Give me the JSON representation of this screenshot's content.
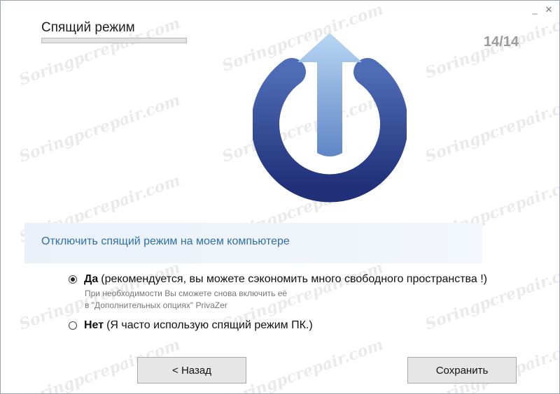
{
  "window": {
    "minimize_glyph": "_",
    "close_glyph": "✕"
  },
  "header": {
    "title": "Спящий режим",
    "counter": "14/14",
    "progress": 1.0
  },
  "section": {
    "heading": "Отключить спящий режим на моем компьютере"
  },
  "options": [
    {
      "bold": "Да",
      "text": "(рекомендуется, вы можете сэкономить много свободного пространства !)",
      "hint_line1": "При необходимости Вы сможете снова включить её",
      "hint_line2": "в \"Дополнительных опциях\" PrivaZer",
      "checked": true
    },
    {
      "bold": "Нет",
      "text": "(Я часто использую спящий режим ПК.)",
      "checked": false
    }
  ],
  "buttons": {
    "back": "< Назад",
    "save": "Сохранить"
  },
  "watermark": "Soringpcrepair.com",
  "colors": {
    "accent_text": "#2f6fa8",
    "power_dark": "#263a86",
    "power_light": "#a9c9ec"
  }
}
